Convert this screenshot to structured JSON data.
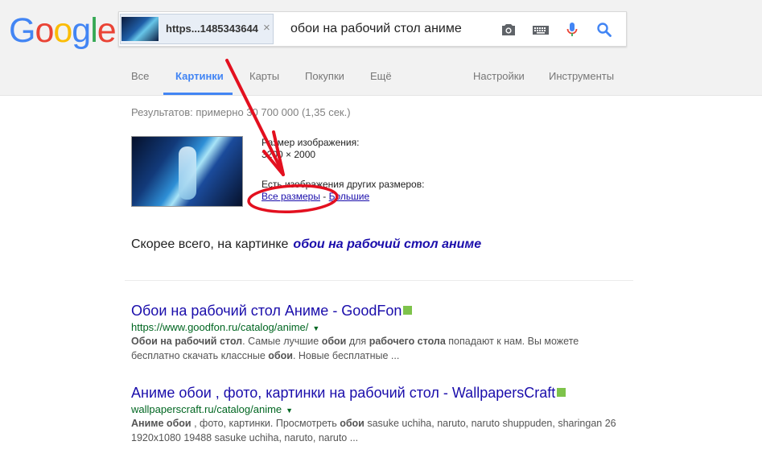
{
  "logo": {
    "letters": [
      "G",
      "o",
      "o",
      "g",
      "l",
      "e"
    ],
    "colors": [
      "#4285f4",
      "#ea4335",
      "#fbbc05",
      "#4285f4",
      "#34a853",
      "#ea4335"
    ]
  },
  "search": {
    "image_chip_label": "https...1485343644",
    "close_glyph": "×",
    "query": "обои на рабочий стол аниме",
    "icons": [
      "camera-icon",
      "keyboard-icon",
      "mic-icon",
      "search-icon"
    ]
  },
  "tabs": [
    {
      "label": "Все"
    },
    {
      "label": "Картинки",
      "active": true
    },
    {
      "label": "Карты"
    },
    {
      "label": "Покупки"
    },
    {
      "label": "Ещё"
    }
  ],
  "tools": {
    "settings": "Настройки",
    "instruments": "Инструменты"
  },
  "stats": "Результатов: примерно 30 700 000 (1,35 сек.)",
  "image_info": {
    "size_label": "Размер изображения:",
    "size_value": "3200 × 2000",
    "other_sizes_label": "Есть изображения других размеров:",
    "all_sizes": "Все размеры",
    "separator": " - ",
    "larger": "Большие"
  },
  "best_guess": {
    "prefix": "Скорее всего, на картинке",
    "query": "обои на рабочий стол аниме"
  },
  "results": [
    {
      "title": "Обои на рабочий стол Аниме - GoodFon",
      "url": "https://www.goodfon.ru/catalog/anime/",
      "snippet_html": "<b>Обои на рабочий стол</b>. Самые лучшие <b>обои</b> для <b>рабочего стола</b> попадают к нам. Вы можете бесплатно скачать классные <b>обои</b>. Новые бесплатные ..."
    },
    {
      "title": "Аниме обои , фото, картинки на рабочий стол - WallpapersCraft",
      "url": "wallpaperscraft.ru/catalog/anime",
      "snippet_html": "<b>Аниме обои</b> , фото, картинки. Просмотреть <b>обои</b> sasuke uchiha, naruto, naruto shuppuden, sharingan 26 1920x1080 19488 sasuke uchiha, naruto, naruto ..."
    }
  ],
  "annotation_color": "#e3101f"
}
